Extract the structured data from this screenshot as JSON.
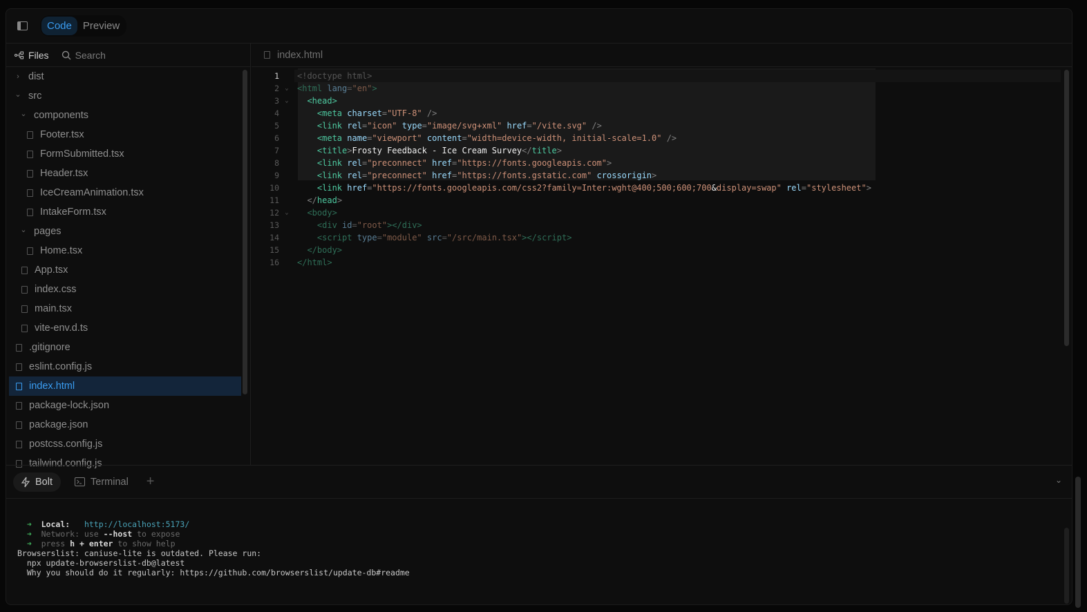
{
  "header": {
    "tabs": [
      {
        "label": "Code",
        "active": true
      },
      {
        "label": "Preview",
        "active": false
      }
    ]
  },
  "sidebar": {
    "files_label": "Files",
    "search_label": "Search",
    "items": [
      {
        "label": "dist",
        "type": "folder",
        "open": false,
        "depth": 0
      },
      {
        "label": "src",
        "type": "folder",
        "open": true,
        "depth": 0
      },
      {
        "label": "components",
        "type": "folder",
        "open": true,
        "depth": 1
      },
      {
        "label": "Footer.tsx",
        "type": "file",
        "depth": 2
      },
      {
        "label": "FormSubmitted.tsx",
        "type": "file",
        "depth": 2
      },
      {
        "label": "Header.tsx",
        "type": "file",
        "depth": 2
      },
      {
        "label": "IceCreamAnimation.tsx",
        "type": "file",
        "depth": 2
      },
      {
        "label": "IntakeForm.tsx",
        "type": "file",
        "depth": 2
      },
      {
        "label": "pages",
        "type": "folder",
        "open": true,
        "depth": 1
      },
      {
        "label": "Home.tsx",
        "type": "file",
        "depth": 2
      },
      {
        "label": "App.tsx",
        "type": "file",
        "depth": 1
      },
      {
        "label": "index.css",
        "type": "file",
        "depth": 1
      },
      {
        "label": "main.tsx",
        "type": "file",
        "depth": 1
      },
      {
        "label": "vite-env.d.ts",
        "type": "file",
        "depth": 1
      },
      {
        "label": ".gitignore",
        "type": "file",
        "depth": 0
      },
      {
        "label": "eslint.config.js",
        "type": "file",
        "depth": 0
      },
      {
        "label": "index.html",
        "type": "file",
        "depth": 0,
        "selected": true
      },
      {
        "label": "package-lock.json",
        "type": "file",
        "depth": 0
      },
      {
        "label": "package.json",
        "type": "file",
        "depth": 0
      },
      {
        "label": "postcss.config.js",
        "type": "file",
        "depth": 0
      },
      {
        "label": "tailwind.config.js",
        "type": "file",
        "depth": 0
      }
    ]
  },
  "editor": {
    "tab": "index.html",
    "lines": [
      {
        "n": "1",
        "fold": false,
        "dim": true,
        "cur": true,
        "tokens": [
          [
            "pun",
            "<!doctype html>"
          ]
        ]
      },
      {
        "n": "2",
        "fold": true,
        "dim": true,
        "tokens": [
          [
            "tag",
            "<html "
          ],
          [
            "attr",
            "lang"
          ],
          [
            "pun",
            "="
          ],
          [
            "str",
            "\"en\""
          ],
          [
            "tag",
            ">"
          ]
        ]
      },
      {
        "n": "3",
        "fold": true,
        "tokens": [
          [
            "txt",
            "  "
          ],
          [
            "tag",
            "<head>"
          ]
        ]
      },
      {
        "n": "4",
        "tokens": [
          [
            "txt",
            "    "
          ],
          [
            "tag",
            "<meta "
          ],
          [
            "attr",
            "charset"
          ],
          [
            "pun",
            "="
          ],
          [
            "str",
            "\"UTF-8\""
          ],
          [
            "pun",
            " />"
          ]
        ]
      },
      {
        "n": "5",
        "tokens": [
          [
            "txt",
            "    "
          ],
          [
            "tag",
            "<link "
          ],
          [
            "attr",
            "rel"
          ],
          [
            "pun",
            "="
          ],
          [
            "str",
            "\"icon\" "
          ],
          [
            "attr",
            "type"
          ],
          [
            "pun",
            "="
          ],
          [
            "str",
            "\"image/svg+xml\" "
          ],
          [
            "attr",
            "href"
          ],
          [
            "pun",
            "="
          ],
          [
            "str",
            "\"/vite.svg\""
          ],
          [
            "pun",
            " />"
          ]
        ]
      },
      {
        "n": "6",
        "tokens": [
          [
            "txt",
            "    "
          ],
          [
            "tag",
            "<meta "
          ],
          [
            "attr",
            "name"
          ],
          [
            "pun",
            "="
          ],
          [
            "str",
            "\"viewport\" "
          ],
          [
            "attr",
            "content"
          ],
          [
            "pun",
            "="
          ],
          [
            "str",
            "\"width=device-width, initial-scale=1.0\""
          ],
          [
            "pun",
            " />"
          ]
        ]
      },
      {
        "n": "7",
        "tokens": [
          [
            "txt",
            "    "
          ],
          [
            "tag",
            "<title"
          ],
          [
            "pun",
            ">"
          ],
          [
            "txt",
            "Frosty Feedback - Ice Cream Survey"
          ],
          [
            "pun",
            "</"
          ],
          [
            "tag",
            "title"
          ],
          [
            "pun",
            ">"
          ]
        ]
      },
      {
        "n": "8",
        "tokens": [
          [
            "txt",
            "    "
          ],
          [
            "tag",
            "<link "
          ],
          [
            "attr",
            "rel"
          ],
          [
            "pun",
            "="
          ],
          [
            "str",
            "\"preconnect\" "
          ],
          [
            "attr",
            "href"
          ],
          [
            "pun",
            "="
          ],
          [
            "str",
            "\"https://fonts.googleapis.com\""
          ],
          [
            "pun",
            ">"
          ]
        ]
      },
      {
        "n": "9",
        "tokens": [
          [
            "txt",
            "    "
          ],
          [
            "tag",
            "<link "
          ],
          [
            "attr",
            "rel"
          ],
          [
            "pun",
            "="
          ],
          [
            "str",
            "\"preconnect\" "
          ],
          [
            "attr",
            "href"
          ],
          [
            "pun",
            "="
          ],
          [
            "str",
            "\"https://fonts.gstatic.com\" "
          ],
          [
            "attr",
            "crossorigin"
          ],
          [
            "pun",
            ">"
          ]
        ]
      },
      {
        "n": "10",
        "tokens": [
          [
            "txt",
            "    "
          ],
          [
            "tag",
            "<link "
          ],
          [
            "attr",
            "href"
          ],
          [
            "pun",
            "="
          ],
          [
            "str",
            "\"https://fonts.googleapis.com/css2?family=Inter:wght@400;500;600;700"
          ],
          [
            "txt",
            "&"
          ],
          [
            "str",
            "display=swap\" "
          ],
          [
            "attr",
            "rel"
          ],
          [
            "pun",
            "="
          ],
          [
            "str",
            "\"stylesheet\""
          ],
          [
            "pun",
            ">"
          ]
        ]
      },
      {
        "n": "11",
        "tokens": [
          [
            "txt",
            "  "
          ],
          [
            "pun",
            "</"
          ],
          [
            "tag",
            "head"
          ],
          [
            "pun",
            ">"
          ]
        ]
      },
      {
        "n": "12",
        "fold": true,
        "dim": true,
        "tokens": [
          [
            "txt",
            "  "
          ],
          [
            "tag",
            "<body>"
          ]
        ]
      },
      {
        "n": "13",
        "dim": true,
        "tokens": [
          [
            "txt",
            "    "
          ],
          [
            "tag",
            "<div "
          ],
          [
            "attr",
            "id"
          ],
          [
            "pun",
            "="
          ],
          [
            "str",
            "\"root\""
          ],
          [
            "tag",
            "></div>"
          ]
        ]
      },
      {
        "n": "14",
        "dim": true,
        "tokens": [
          [
            "txt",
            "    "
          ],
          [
            "tag",
            "<script "
          ],
          [
            "attr",
            "type"
          ],
          [
            "pun",
            "="
          ],
          [
            "str",
            "\"module\" "
          ],
          [
            "attr",
            "src"
          ],
          [
            "pun",
            "="
          ],
          [
            "str",
            "\"/src/main.tsx\""
          ],
          [
            "tag",
            "></script>"
          ]
        ]
      },
      {
        "n": "15",
        "dim": true,
        "tokens": [
          [
            "txt",
            "  "
          ],
          [
            "tag",
            "</body>"
          ]
        ]
      },
      {
        "n": "16",
        "dim": true,
        "tokens": [
          [
            "tag",
            "</html>"
          ]
        ]
      }
    ]
  },
  "bottom": {
    "tabs": [
      {
        "label": "Bolt",
        "active": true
      },
      {
        "label": "Terminal",
        "active": false
      }
    ],
    "terminal": [
      [
        [
          "t-arrow",
          "  ➜  "
        ],
        [
          "t-b",
          "Local:   "
        ],
        [
          "t-url",
          "http://localhost:5173/"
        ]
      ],
      [
        [
          "t-arrow",
          "  ➜  "
        ],
        [
          "t-dim",
          "Network: use "
        ],
        [
          "t-b",
          "--host"
        ],
        [
          "t-dim",
          " to expose"
        ]
      ],
      [
        [
          "t-arrow",
          "  ➜  "
        ],
        [
          "t-dim",
          "press "
        ],
        [
          "t-b",
          "h + enter"
        ],
        [
          "t-dim",
          " to show help"
        ]
      ],
      [
        [
          "",
          "Browserslist: caniuse-lite is outdated. Please run:"
        ]
      ],
      [
        [
          "",
          "  npx update-browserslist-db@latest"
        ]
      ],
      [
        [
          "",
          "  Why you should do it regularly: https://github.com/browserslist/update-db#readme"
        ]
      ]
    ]
  }
}
